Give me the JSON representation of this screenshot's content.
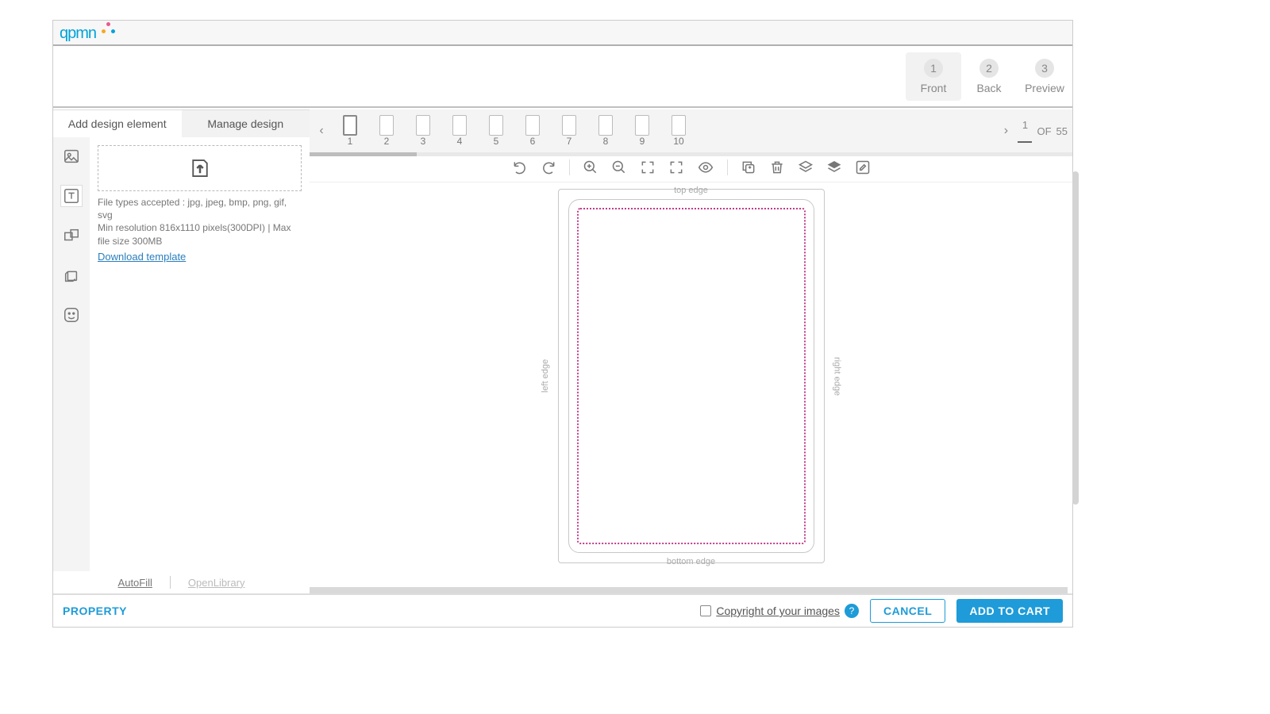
{
  "logo": {
    "text": "qpmn"
  },
  "steps": [
    {
      "num": "1",
      "label": "Front",
      "active": true
    },
    {
      "num": "2",
      "label": "Back",
      "active": false
    },
    {
      "num": "3",
      "label": "Preview",
      "active": false
    }
  ],
  "tabs": {
    "add": "Add design element",
    "manage": "Manage design"
  },
  "upload": {
    "hint_line1": "File types accepted : jpg, jpeg, bmp, png, gif, svg",
    "hint_line2": "Min resolution 816x1110 pixels(300DPI) | Max file size 300MB",
    "download": "Download template"
  },
  "bottom_links": {
    "autofill": "AutoFill",
    "openlibrary": "OpenLibrary"
  },
  "thumbs": [
    "1",
    "2",
    "3",
    "4",
    "5",
    "6",
    "7",
    "8",
    "9",
    "10"
  ],
  "page": {
    "current": "1",
    "of_label": "OF",
    "total": "55"
  },
  "canvas": {
    "top": "top edge",
    "bottom": "bottom edge",
    "left": "left edge",
    "right": "right edge"
  },
  "footer": {
    "property": "PROPERTY",
    "copyright": "Copyright of your images",
    "cancel": "CANCEL",
    "add": "ADD TO CART"
  }
}
